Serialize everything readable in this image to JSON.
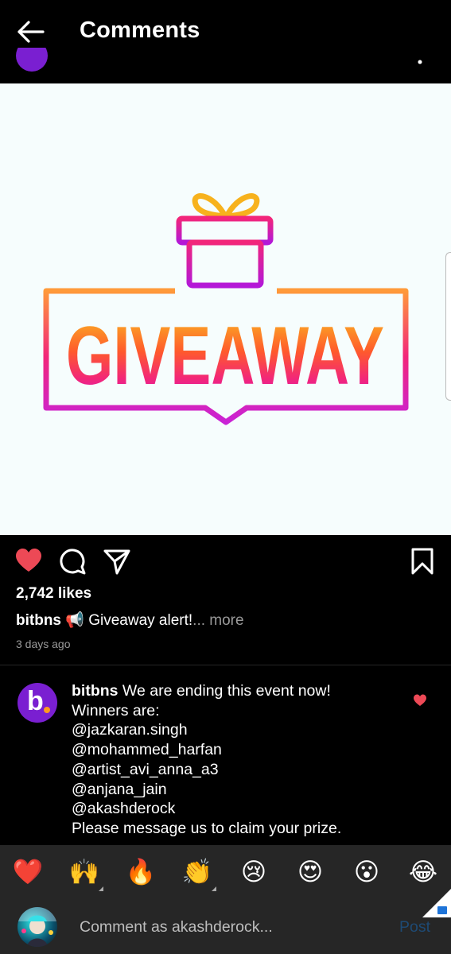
{
  "header": {
    "title": "Comments"
  },
  "post": {
    "image": {
      "graphic_text": "GIVEAWAY"
    },
    "likes": "2,742 likes",
    "caption_user": "bitbns",
    "caption_text": "📢 Giveaway alert!",
    "caption_more": "... more",
    "time": "3 days ago"
  },
  "comment": {
    "user": "bitbns",
    "avatar_letter": "b",
    "lines": [
      "We are ending this event now!",
      "Winners are:",
      "@jazkaran.singh",
      "@mohammed_harfan",
      "@artist_avi_anna_a3",
      "@anjana_jain",
      "@akashderock",
      "Please message us to claim your prize."
    ]
  },
  "reactions": [
    "❤️",
    "🙌",
    "🔥",
    "👏",
    "😢",
    "😍",
    "😮",
    "😂"
  ],
  "compose": {
    "placeholder": "Comment as akashderock...",
    "post_label": "Post"
  },
  "colors": {
    "like_red": "#ed4956",
    "post_button_disabled": "#1e4a74",
    "avatar_purple": "#7a1fd1"
  }
}
